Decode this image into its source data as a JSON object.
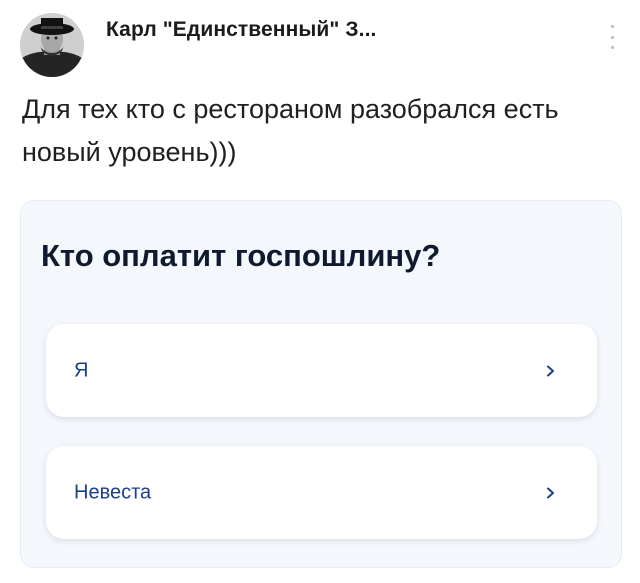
{
  "post": {
    "author": "Карл \"Единственный\" З...",
    "text": "Для тех кто с рестораном разобрался есть новый уровень)))",
    "more_icon": "more-vertical-icon"
  },
  "card": {
    "question": "Кто оплатит госпошлину?",
    "options": [
      {
        "label": "Я",
        "icon": "chevron-right-icon"
      },
      {
        "label": "Невеста",
        "icon": "chevron-right-icon"
      }
    ]
  },
  "colors": {
    "card_background": "#f4f7fc",
    "question_text": "#101a2f",
    "option_text": "#1c3f89",
    "chevron": "#1c3f89"
  }
}
